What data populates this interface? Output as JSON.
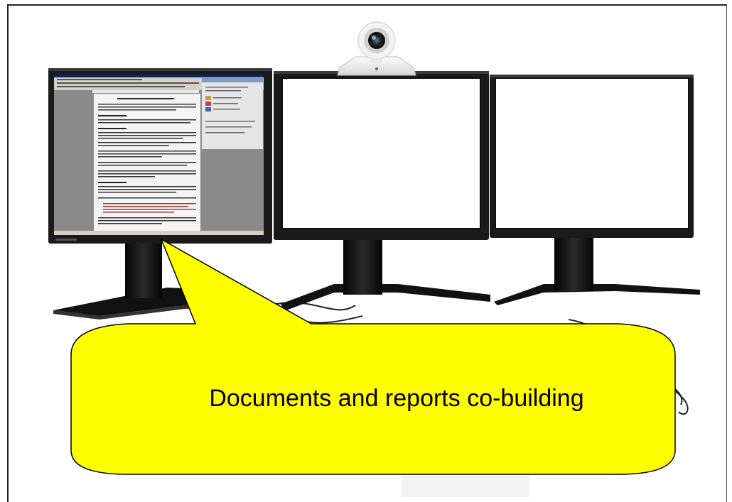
{
  "callout": {
    "text": "Documents and reports co-building",
    "fill": "#ffff00"
  },
  "scene": {
    "monitors": [
      "document-monitor",
      "blank-monitor-center",
      "blank-monitor-right"
    ],
    "webcam": "webcam-icon"
  },
  "colors": {
    "bezel": "#1a1a1a",
    "stand": "#111111",
    "screen_blank": "#ffffff",
    "doc_page": "#f4f4f4",
    "doc_app_bg": "#8a8a8a",
    "callout_stroke": "#000000"
  }
}
